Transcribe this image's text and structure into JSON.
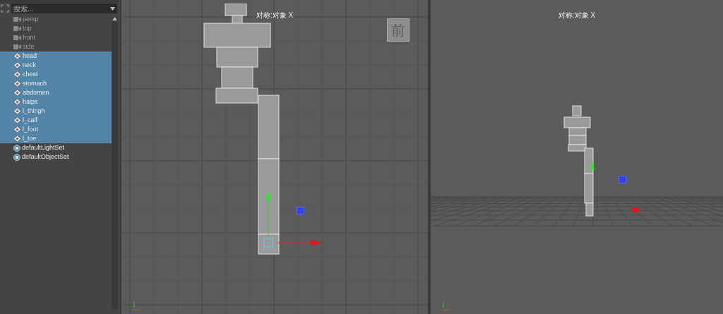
{
  "outliner": {
    "search": {
      "placeholder": "搜索..."
    },
    "items": [
      {
        "label": "persp",
        "kind": "camera",
        "selected": false,
        "disabled": true
      },
      {
        "label": "top",
        "kind": "camera",
        "selected": false,
        "disabled": true
      },
      {
        "label": "front",
        "kind": "camera",
        "selected": false,
        "disabled": true
      },
      {
        "label": "side",
        "kind": "camera",
        "selected": false,
        "disabled": true
      },
      {
        "label": "head",
        "kind": "joint",
        "selected": true,
        "disabled": false
      },
      {
        "label": "neck",
        "kind": "joint",
        "selected": true,
        "disabled": false
      },
      {
        "label": "chest",
        "kind": "joint",
        "selected": true,
        "disabled": false
      },
      {
        "label": "stomach",
        "kind": "joint",
        "selected": true,
        "disabled": false
      },
      {
        "label": "abdomen",
        "kind": "joint",
        "selected": true,
        "disabled": false
      },
      {
        "label": "haips",
        "kind": "joint",
        "selected": true,
        "disabled": false
      },
      {
        "label": "l_thingh",
        "kind": "joint",
        "selected": true,
        "disabled": false
      },
      {
        "label": "l_calf",
        "kind": "joint",
        "selected": true,
        "disabled": false
      },
      {
        "label": "l_foot",
        "kind": "joint",
        "selected": true,
        "disabled": false
      },
      {
        "label": "l_toe",
        "kind": "joint",
        "selected": true,
        "disabled": false
      },
      {
        "label": "defaultLightSet",
        "kind": "set",
        "selected": false,
        "disabled": false
      },
      {
        "label": "defaultObjectSet",
        "kind": "set",
        "selected": false,
        "disabled": false
      }
    ]
  },
  "viewports": [
    {
      "kind": "ortho",
      "label": "对称:对象 X",
      "view_cube_label": "前"
    },
    {
      "kind": "persp",
      "label": "对称:对象 X"
    }
  ]
}
